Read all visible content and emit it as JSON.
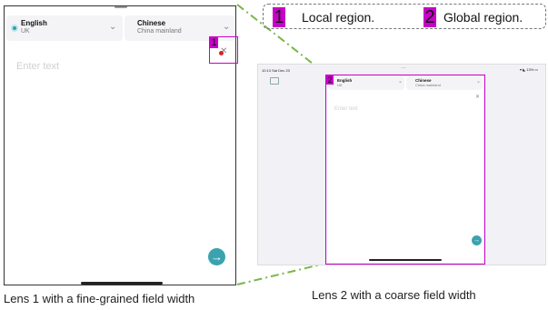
{
  "legend": {
    "items": [
      {
        "num": "1",
        "label": "Local region."
      },
      {
        "num": "2",
        "label": "Global region."
      }
    ]
  },
  "lens1": {
    "caption": "Lens 1 with a fine-grained field width",
    "region_tag": "1",
    "source_lang": {
      "name": "English",
      "region": "UK"
    },
    "target_lang": {
      "name": "Chinese",
      "region": "China mainland"
    },
    "placeholder": "Enter text"
  },
  "lens2": {
    "caption": "Lens 2 with a coarse field width",
    "region_tag": "2",
    "status_time": "10:13  Sat Dec 23",
    "status_right": "▾ ◣ 13% ▭",
    "source_lang": {
      "name": "English",
      "region": "UK"
    },
    "target_lang": {
      "name": "Chinese",
      "region": "China mainland"
    },
    "placeholder": "Enter text"
  },
  "colors": {
    "highlight": "#c800c8",
    "connector": "#7ab648",
    "accent": "#2aa3b3"
  }
}
